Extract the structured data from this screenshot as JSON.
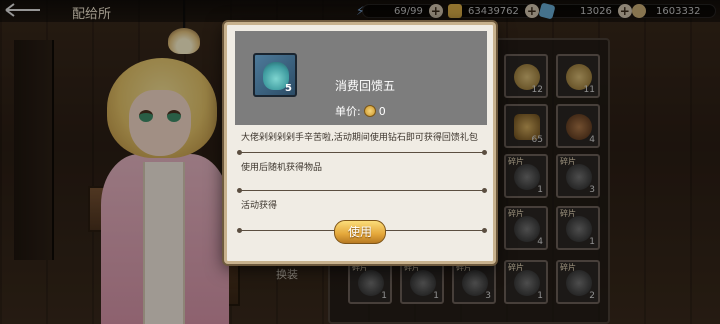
{
  "header": {
    "title": "配给所",
    "back_icon": "back-arrow-icon"
  },
  "resources": [
    {
      "name": "stamina",
      "icon": "lightning-icon",
      "value": "69/99",
      "color": "#7aa6d8"
    },
    {
      "name": "gold",
      "icon": "coin-icon",
      "value": "63439762",
      "color": "#e0b24a"
    },
    {
      "name": "card",
      "icon": "card-icon",
      "value": "13026",
      "color": "#6ab0d8"
    },
    {
      "name": "gem",
      "icon": "gem-icon",
      "value": "1603332",
      "color": "#d0b27a"
    }
  ],
  "inventory": {
    "tab_label": "换装",
    "cells": [
      {
        "tag": "",
        "count": "12"
      },
      {
        "tag": "",
        "count": "11"
      },
      {
        "tag": "",
        "count": "65"
      },
      {
        "tag": "",
        "count": "4"
      },
      {
        "tag": "碎片",
        "count": "1"
      },
      {
        "tag": "碎片",
        "count": "3"
      },
      {
        "tag": "碎片",
        "count": "4"
      },
      {
        "tag": "碎片",
        "count": "1"
      },
      {
        "tag": "碎片",
        "count": "1"
      },
      {
        "tag": "碎片",
        "count": "2"
      }
    ],
    "bottom_row": [
      {
        "tag": "碎片",
        "count": "1"
      },
      {
        "tag": "碎片",
        "count": "1"
      },
      {
        "tag": "碎片",
        "count": "3"
      },
      {
        "tag": "碎片",
        "count": "1"
      }
    ]
  },
  "modal": {
    "item_name": "消费回馈五",
    "item_count": "5",
    "price_label": "单价:",
    "price_value": "0",
    "description": "大佬剁剁剁剁手辛苦啦,活动期间使用钻石即可获得回馈礼包",
    "effect": "使用后随机获得物品",
    "source": "活动获得",
    "use_button": "使用"
  }
}
